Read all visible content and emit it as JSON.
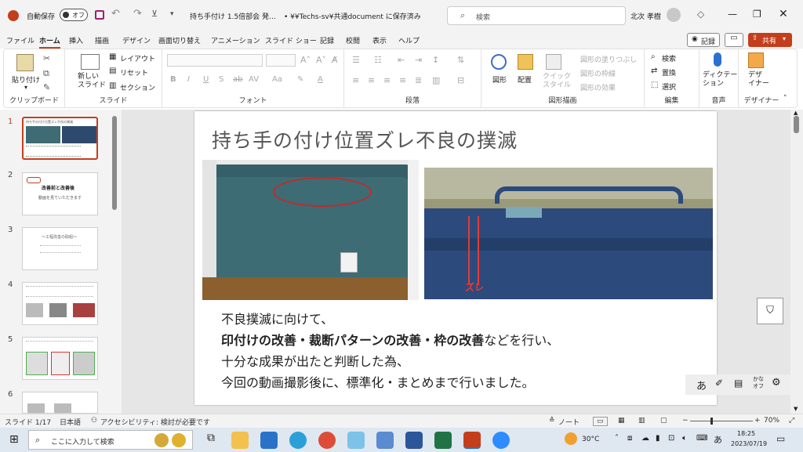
{
  "titlebar": {
    "autosave_label": "自動保存",
    "autosave_state": "オフ",
    "doc_title": "持ち手付け 1.5倍部会 発…",
    "save_status": "• ¥¥Techs-sv¥共通document に保存済み",
    "search_placeholder": "検索",
    "user_name": "北次 孝樹"
  },
  "menu": {
    "items": [
      "ファイル",
      "ホーム",
      "挿入",
      "描画",
      "デザイン",
      "画面切り替え",
      "アニメーション",
      "スライド ショー",
      "記録",
      "校閲",
      "表示",
      "ヘルプ"
    ],
    "active": "ホーム",
    "record_button": "記録",
    "share_button": "共有"
  },
  "ribbon": {
    "clipboard": {
      "paste": "貼り付け",
      "label": "クリップボード"
    },
    "slides": {
      "new_slide": "新しい\nスライド",
      "layout": "レイアウト",
      "reset": "リセット",
      "section": "セクション",
      "label": "スライド"
    },
    "font": {
      "label": "フォント"
    },
    "paragraph": {
      "label": "段落"
    },
    "drawing": {
      "shapes": "図形",
      "arrange": "配置",
      "quick_styles": "クイック\nスタイル",
      "fill": "図形の塗りつぶし",
      "outline": "図形の枠線",
      "effects": "図形の効果",
      "label": "図形描画"
    },
    "editing": {
      "find": "検索",
      "replace": "置換",
      "select": "選択",
      "label": "編集"
    },
    "voice": {
      "dictate": "ディクテー\nション",
      "label": "音声"
    },
    "designer": {
      "button": "デザ\nイナー",
      "label": "デザイナー"
    }
  },
  "thumbnails": [
    {
      "num": "1",
      "text": "持ち手の付け位置ズレ不良の撲滅"
    },
    {
      "num": "2",
      "text": "改善前と改善後",
      "sub": "動画を見ていただきます"
    },
    {
      "num": "3",
      "text": "～工程改善の取組～"
    },
    {
      "num": "4",
      "text": ""
    },
    {
      "num": "5",
      "text": ""
    },
    {
      "num": "6",
      "text": ""
    }
  ],
  "slide": {
    "title": "持ち手の付け位置ズレ不良の撲滅",
    "photo_label": "ズレ",
    "line1": "不良撲滅に向けて、",
    "line2_bold": "印付けの改善・裁断パターンの改善・枠の改善",
    "line2_rest": "などを行い、",
    "line3": "十分な成果が出たと判断した為、",
    "line4": "今回の動画撮影後に、標準化・まとめまで行いました。"
  },
  "status": {
    "slide_no": "スライド 1/17",
    "language": "日本語",
    "accessibility": "アクセシビリティ: 検討が必要です",
    "notes": "ノート",
    "zoom": "70%"
  },
  "taskbar": {
    "search_placeholder": "ここに入力して検索",
    "temperature": "30°C",
    "time": "18:25",
    "date": "2023/07/19",
    "ime": "あ"
  },
  "ime_toolbar": {
    "mode": "あ",
    "kana": "かな\nオフ"
  }
}
